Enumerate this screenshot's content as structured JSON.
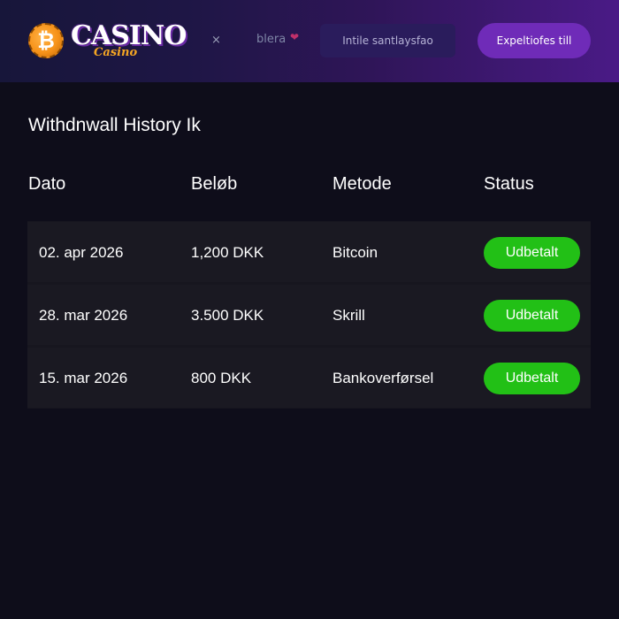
{
  "header": {
    "logo": {
      "coin_symbol": "₿",
      "main_text": "CASINO",
      "sub_text": "Casino"
    },
    "nav": {
      "close_symbol": "×",
      "brand_text": "blera",
      "heart_symbol": "❤",
      "input_text": "Intile santlaysfao",
      "button_label": "Expeltiofes till"
    }
  },
  "main": {
    "title": "Withdnwall History Ik",
    "columns": [
      "Dato",
      "Beløb",
      "Metode",
      "Status"
    ],
    "rows": [
      {
        "date": "02. apr 2026",
        "amount": "1,200 DKK",
        "method": "Bitcoin",
        "status": "Udbetalt"
      },
      {
        "date": "28. mar 2026",
        "amount": "3.500 DKK",
        "method": "Skrill",
        "status": "Udbetalt"
      },
      {
        "date": "15. mar 2026",
        "amount": "800 DKK",
        "method": "Bankoverførsel",
        "status": "Udbetalt"
      }
    ]
  },
  "colors": {
    "background": "#0e0d1a",
    "header_gradient_start": "#17163a",
    "header_gradient_end": "#4a1a86",
    "accent_purple": "#6f2bb8",
    "status_green": "#22c016",
    "coin_orange": "#f7931a"
  },
  "icons": {
    "logo_coin": "bitcoin-coin-icon",
    "close": "close-icon",
    "heart": "heart-icon"
  }
}
